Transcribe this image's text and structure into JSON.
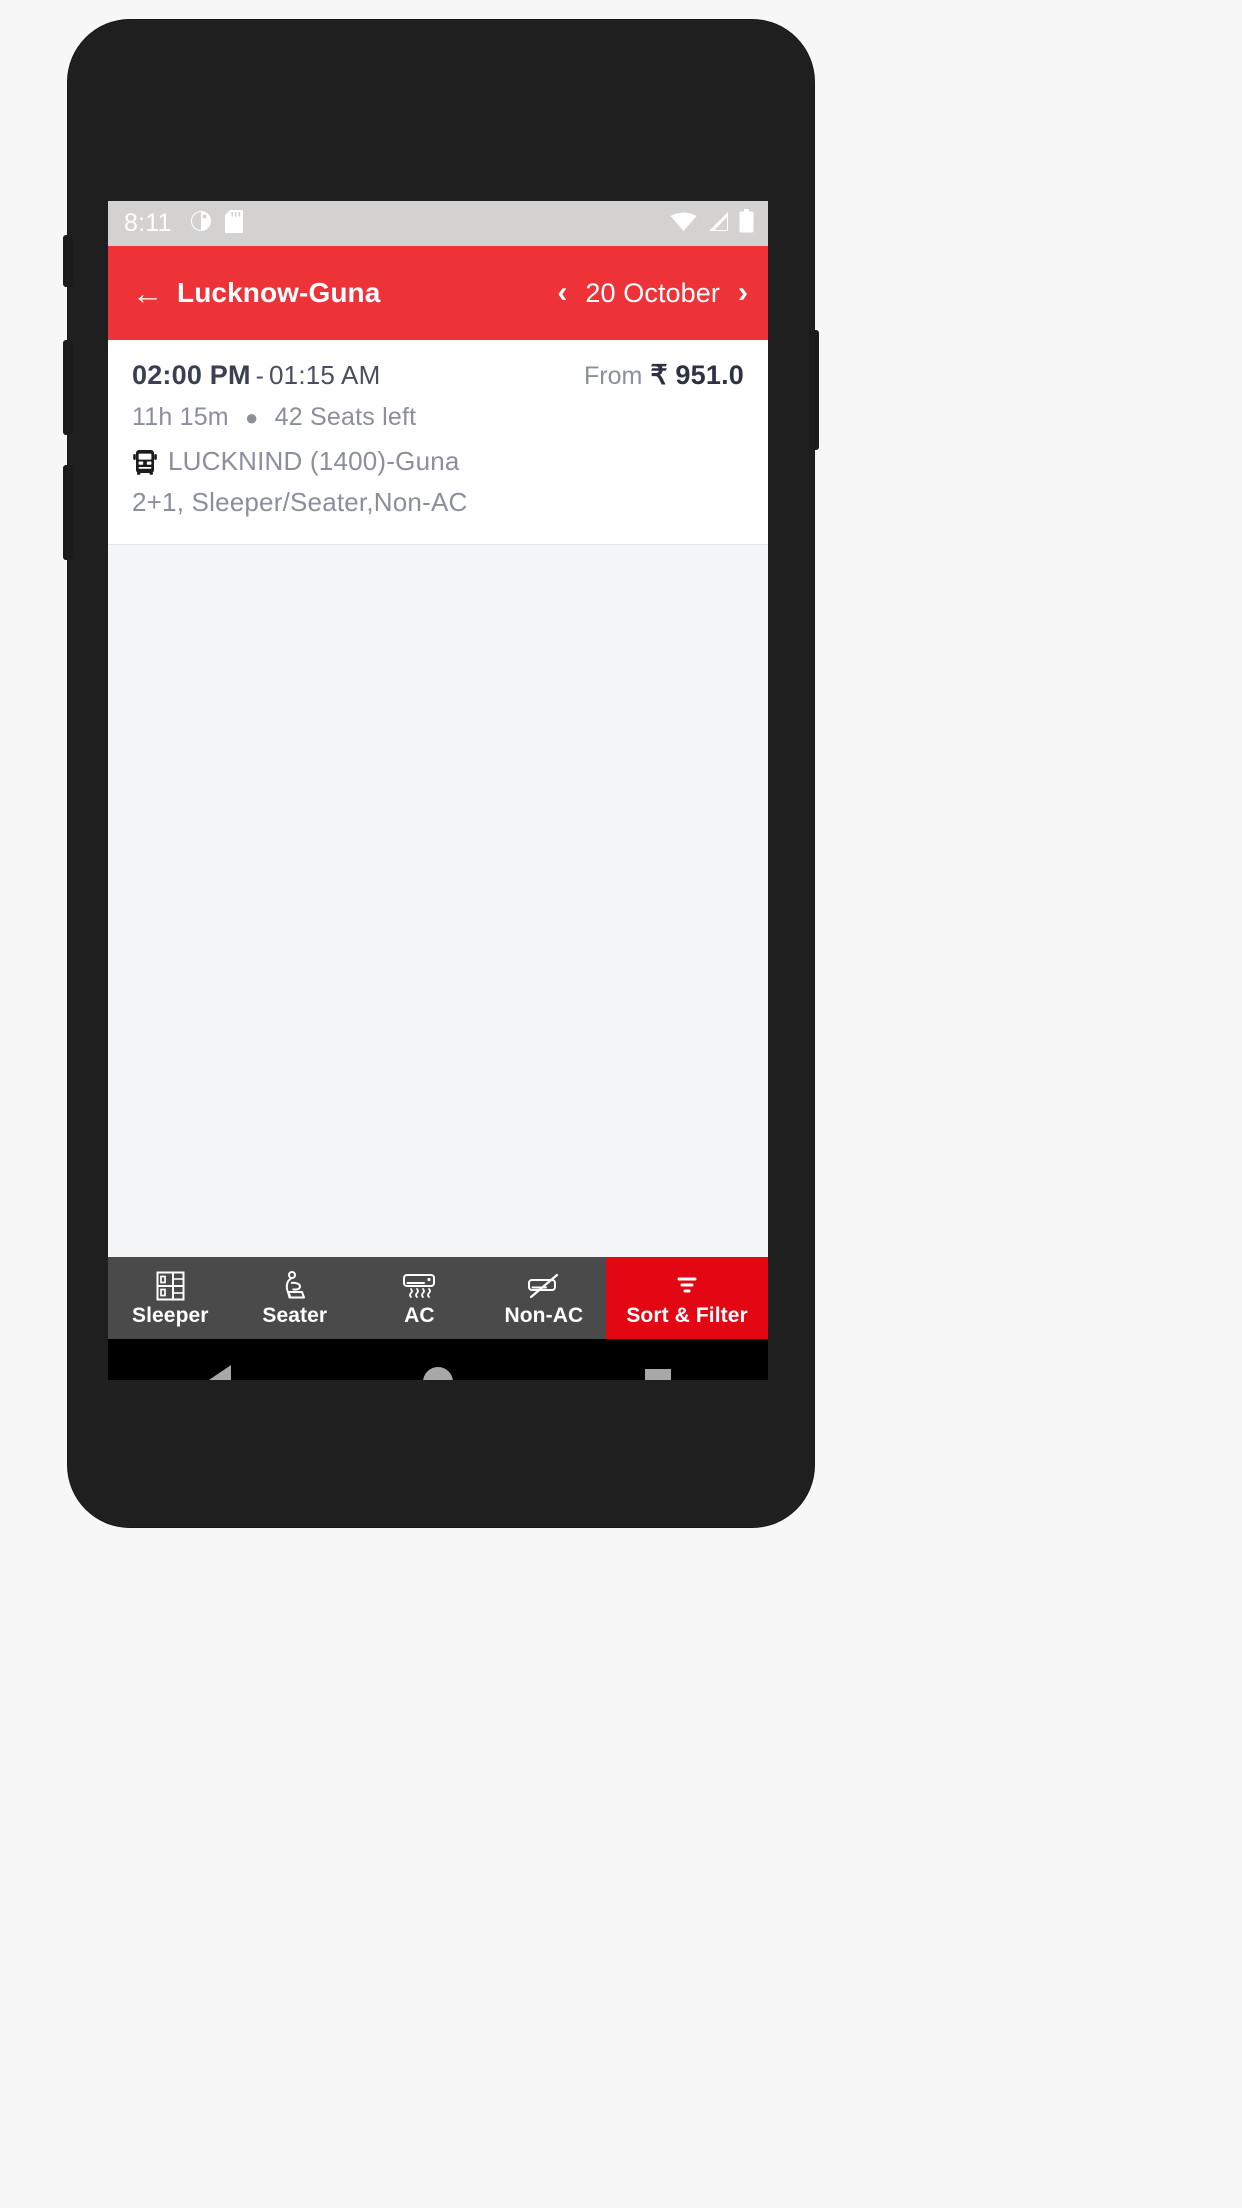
{
  "status_bar": {
    "clock": "8:11",
    "icons_left": [
      "app-notification-icon",
      "sd-card-icon"
    ],
    "icons_right": [
      "wifi-icon",
      "cellular-signal-icon",
      "battery-icon"
    ],
    "background_color": "#d4d1d1",
    "text_color": "#ffffff"
  },
  "app_bar": {
    "back_label": "←",
    "title": "Lucknow-Guna",
    "prev_day_label": "‹",
    "date": "20 October",
    "next_day_label": "›",
    "background_color": "#ee3338"
  },
  "results": {
    "background_color": "#f3f5f7",
    "buses": [
      {
        "departure_time": "02:00 PM",
        "separator": "-",
        "arrival_time": "01:15 AM",
        "price_prefix": "From",
        "price": "₹ 951.0",
        "duration": "11h 15m",
        "dot": "●",
        "seats": "42 Seats left",
        "operator": "LUCKNIND (1400)-Guna",
        "amenities": "2+1, Sleeper/Seater,Non-AC"
      }
    ]
  },
  "filter_bar": {
    "background_color": "#4a4a4a",
    "items": [
      {
        "label": "Sleeper",
        "icon": "sleeper-berth-icon",
        "active": false
      },
      {
        "label": "Seater",
        "icon": "seat-icon",
        "active": false
      },
      {
        "label": "AC",
        "icon": "air-conditioner-icon",
        "active": false
      },
      {
        "label": "Non-AC",
        "icon": "air-conditioner-off-icon",
        "active": false
      }
    ],
    "sort_filter": {
      "label": "Sort & Filter",
      "icon": "funnel-filter-icon",
      "background_color": "#e30613"
    }
  },
  "nav_bar": {
    "back": "back-triangle-icon",
    "home": "home-circle-icon",
    "recents": "recents-square-icon",
    "background_color": "#000000"
  }
}
